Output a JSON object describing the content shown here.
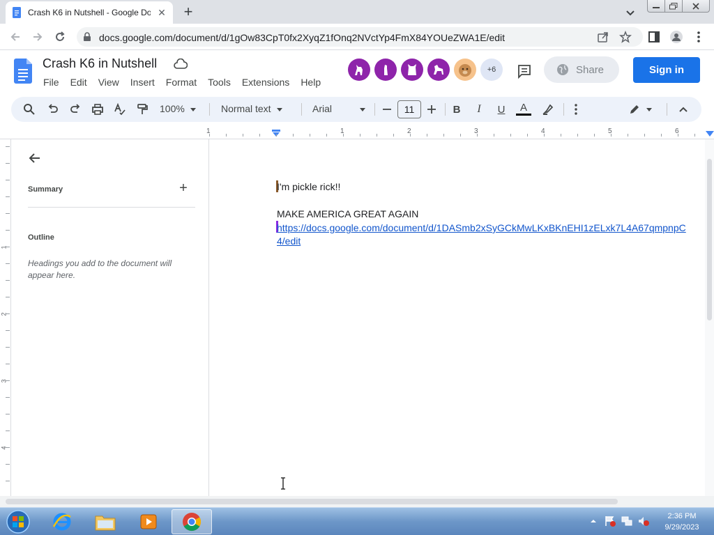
{
  "browser": {
    "tab_title": "Crash K6 in Nutshell - Google Do",
    "tab_close": "✕",
    "new_tab": "+",
    "url": "docs.google.com/document/d/1gOw83CpT0fx2XyqZ1fOnq2NVctYp4FmX84YOUeZWA1E/edit"
  },
  "docs": {
    "title": "Crash K6 in Nutshell",
    "menu": [
      "File",
      "Edit",
      "View",
      "Insert",
      "Format",
      "Tools",
      "Extensions",
      "Help"
    ],
    "collaborators_more": "+6",
    "share_label": "Share",
    "signin_label": "Sign in",
    "colors": {
      "avatar": "#8e24aa",
      "accent": "#1a73e8"
    }
  },
  "toolbar": {
    "zoom": "100%",
    "style": "Normal text",
    "font": "Arial",
    "font_size": "11",
    "bold": "B",
    "italic": "I",
    "underline": "U",
    "text_color_glyph": "A"
  },
  "ruler": {
    "h_numbers": [
      "1",
      "1",
      "2",
      "3",
      "4",
      "5",
      "6"
    ],
    "v_numbers": [
      "1",
      "2",
      "3",
      "4"
    ]
  },
  "outline": {
    "summary_label": "Summary",
    "add_glyph": "+",
    "outline_label": "Outline",
    "hint": "Headings you add to the document will appear here."
  },
  "document": {
    "line1": "I'm pickle rick!!",
    "line2": "MAKE AMERICA GREAT AGAIN",
    "link_line1": "https://docs.google.com/document/d/1DASmb2xSyGCkMwLKxBKnEHI1zELxk7L4A67qmpnpC",
    "link_line2": "4/edit"
  },
  "taskbar": {
    "time": "2:36 PM",
    "date": "9/29/2023"
  }
}
